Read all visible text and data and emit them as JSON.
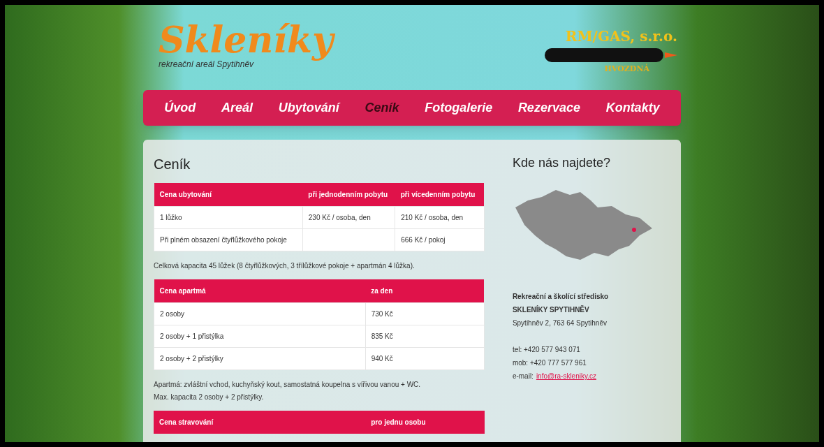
{
  "logo": {
    "title": "Skleníky",
    "subtitle": "rekreační areál Spytihněv"
  },
  "partner_logo": {
    "title": "RM/GAS, s.r.o.",
    "subtitle": "HVOZDNÁ"
  },
  "nav": [
    {
      "label": "Úvod",
      "selected": false
    },
    {
      "label": "Areál",
      "selected": false
    },
    {
      "label": "Ubytování",
      "selected": false
    },
    {
      "label": "Ceník",
      "selected": true
    },
    {
      "label": "Fotogalerie",
      "selected": false
    },
    {
      "label": "Rezervace",
      "selected": false
    },
    {
      "label": "Kontakty",
      "selected": false
    }
  ],
  "main": {
    "heading": "Ceník",
    "blocks": [
      {
        "kind": "table",
        "columns": [
          "Cena ubytování",
          "při jednodenním pobytu",
          "při vícedenním pobytu"
        ],
        "rows": [
          [
            "1 lůžko",
            "230 Kč / osoba, den",
            "210 Kč / osoba, den"
          ],
          [
            "Při plném obsazení čtyřlůžkového pokoje",
            "",
            "666 Kč / pokoj"
          ]
        ]
      },
      {
        "kind": "text",
        "lines": [
          "Celková kapacita 45 lůžek (8 čtyřlůžkových, 3 třílůžkové pokoje + apartmán 4 lůžka)."
        ]
      },
      {
        "kind": "table",
        "columns": [
          "Cena apartmá",
          "za den"
        ],
        "rows": [
          [
            "2 osoby",
            "730 Kč"
          ],
          [
            "2 osoby + 1 přistýlka",
            "835 Kč"
          ],
          [
            "2 osoby + 2 přistýlky",
            "940 Kč"
          ]
        ]
      },
      {
        "kind": "text",
        "lines": [
          "Apartmá: zvláštní vchod, kuchyňský kout, samostatná koupelna s vířivou vanou + WC.",
          "Max. kapacita 2 osoby + 2 přistýlky."
        ]
      },
      {
        "kind": "table",
        "columns": [
          "Cena stravování",
          "pro jednu osobu"
        ]
      }
    ]
  },
  "sidebar": {
    "heading": "Kde nás najdete?",
    "org": "Rekreační a školící středisko",
    "name": "SKLENÍKY SPYTIHNĚV",
    "address": "Spytihněv 2, 763 64 Spytihněv",
    "phone": "tel: +420 577 943 071",
    "mobile": "mob: +420 777 577 961",
    "email_label": "e-mail:",
    "email": "info@ra-skleniky.cz"
  }
}
